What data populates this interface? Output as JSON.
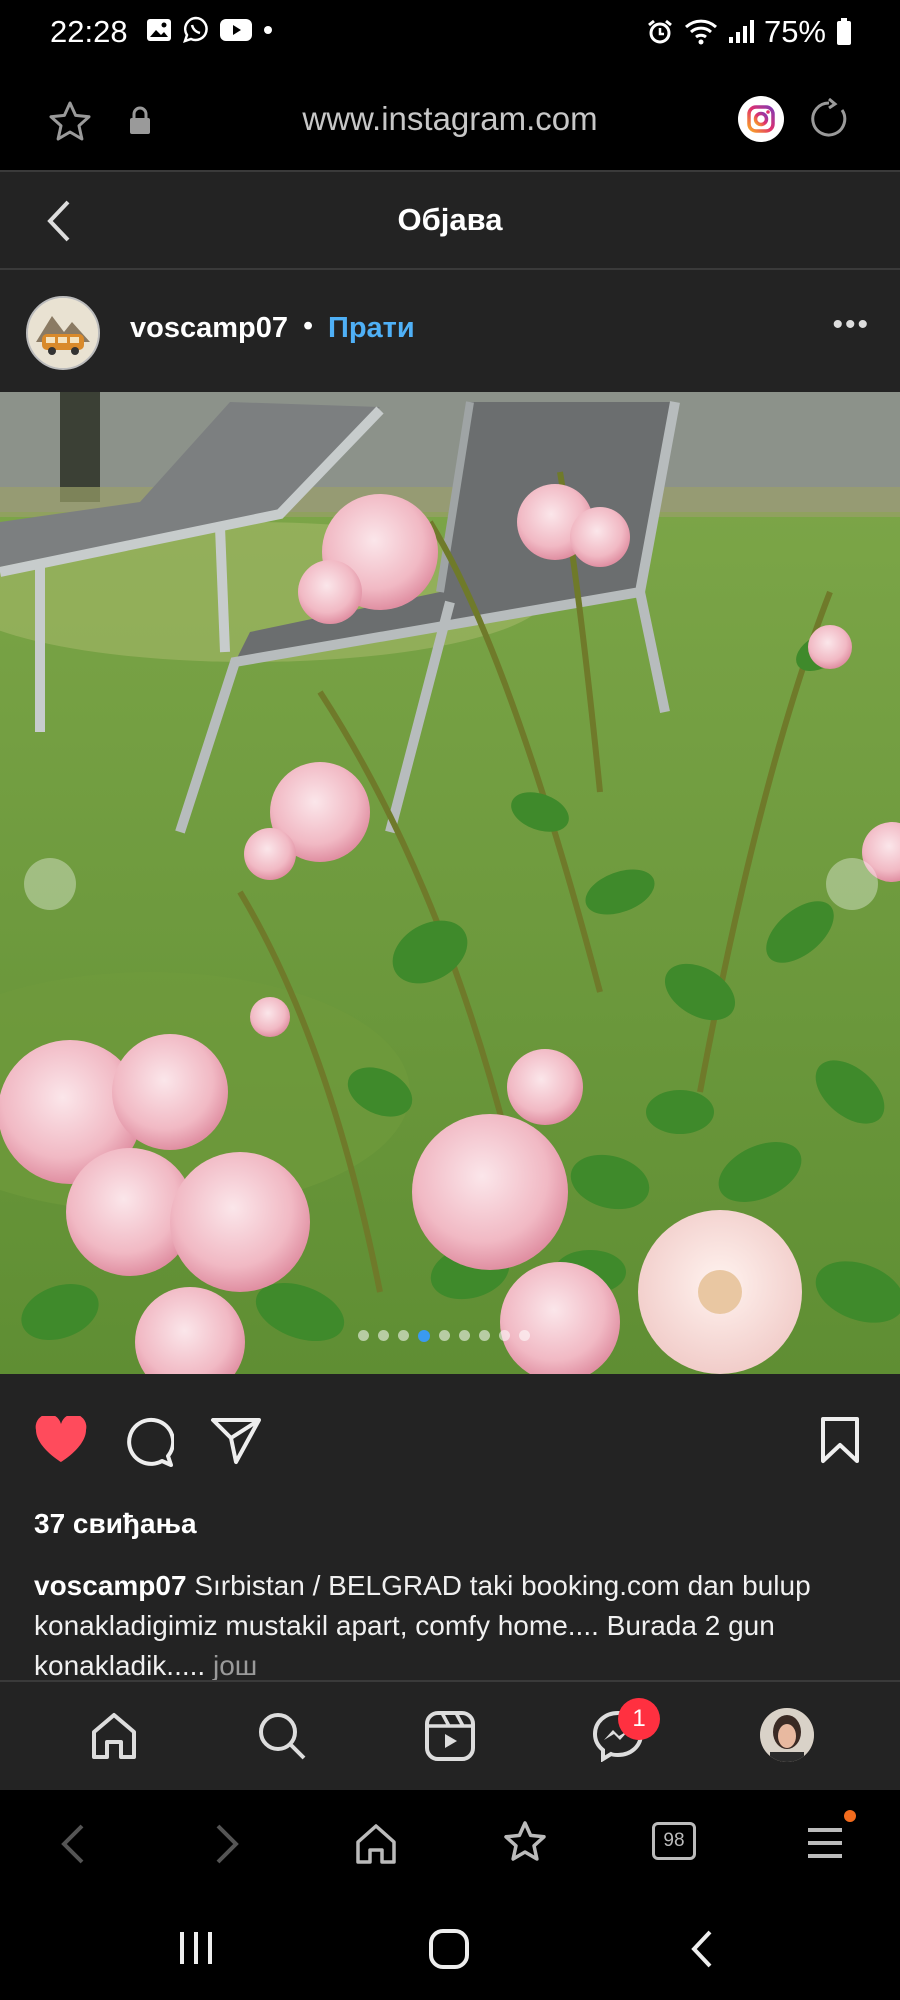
{
  "status_bar": {
    "time": "22:28",
    "battery": "75%"
  },
  "browser": {
    "url": "www.instagram.com",
    "tab_count": "98"
  },
  "post_header": {
    "title": "Објава"
  },
  "post": {
    "username": "voscamp07",
    "separator": "•",
    "follow_label": "Прати",
    "more_label": "•••",
    "image_count": 9,
    "active_image": 4,
    "likes": "37 свиђања",
    "caption": "Sırbistan / BELGRAD taki booking.com dan bulup konakladigimiz mustakil apart, comfy home.... Burada 2 gun konakladik.....",
    "more_link": "још"
  },
  "bottom_nav": {
    "messages_badge": "1"
  },
  "colors": {
    "accent_blue": "#4fb0f6",
    "like_red": "#ff4b5c",
    "badge_red": "#ff3040",
    "panel": "#232323"
  }
}
